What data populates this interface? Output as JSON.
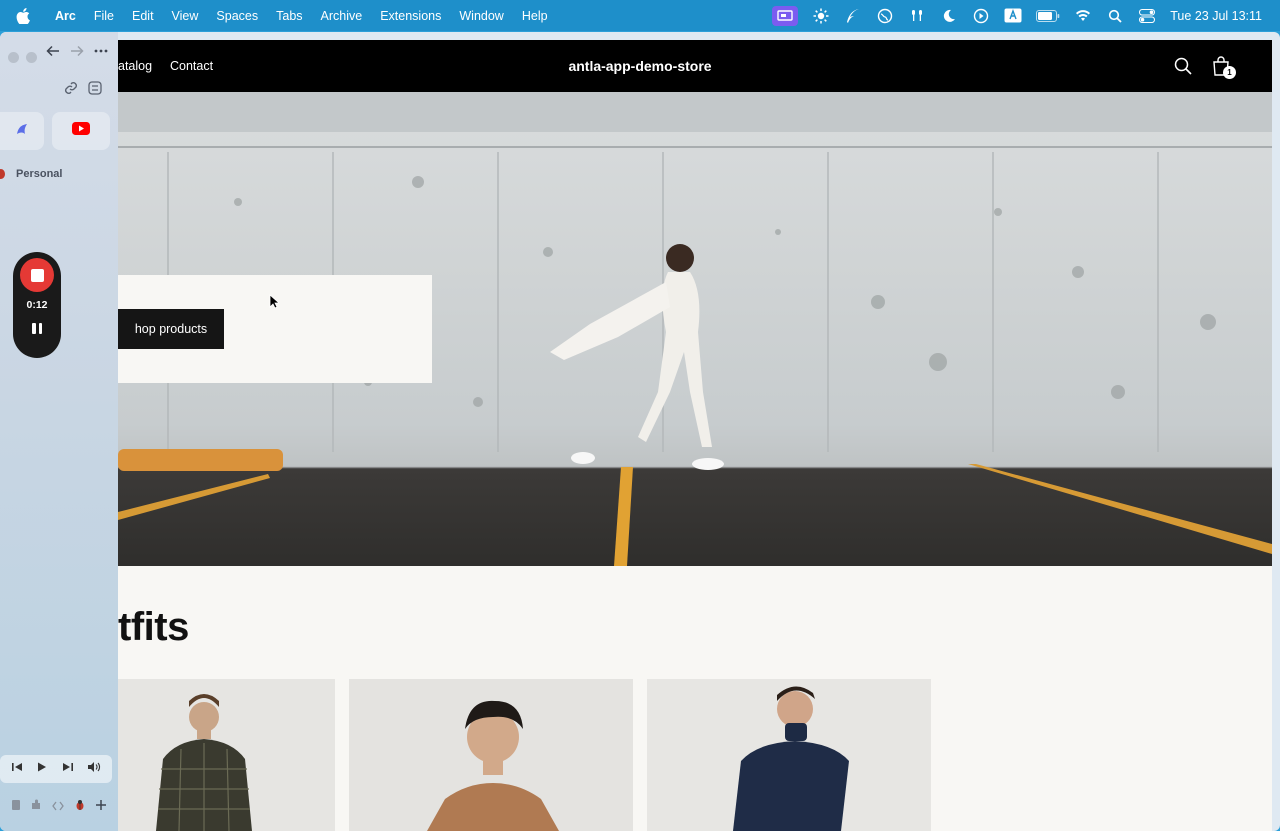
{
  "menubar": {
    "app_name": "Arc",
    "items": [
      "File",
      "Edit",
      "View",
      "Spaces",
      "Tabs",
      "Archive",
      "Extensions",
      "Window",
      "Help"
    ],
    "clock": "Tue 23 Jul  13:11"
  },
  "sidebar": {
    "space_label": "Personal",
    "recorder_time": "0:12"
  },
  "store": {
    "nav": [
      "atalog",
      "Contact"
    ],
    "title": "antla-app-demo-store",
    "cart_count": "1",
    "hero_button": "hop products",
    "section_title": "tfits"
  },
  "colors": {
    "menubar_bg": "#1e8fca",
    "header_bg": "#000000",
    "record_red": "#e53935"
  }
}
